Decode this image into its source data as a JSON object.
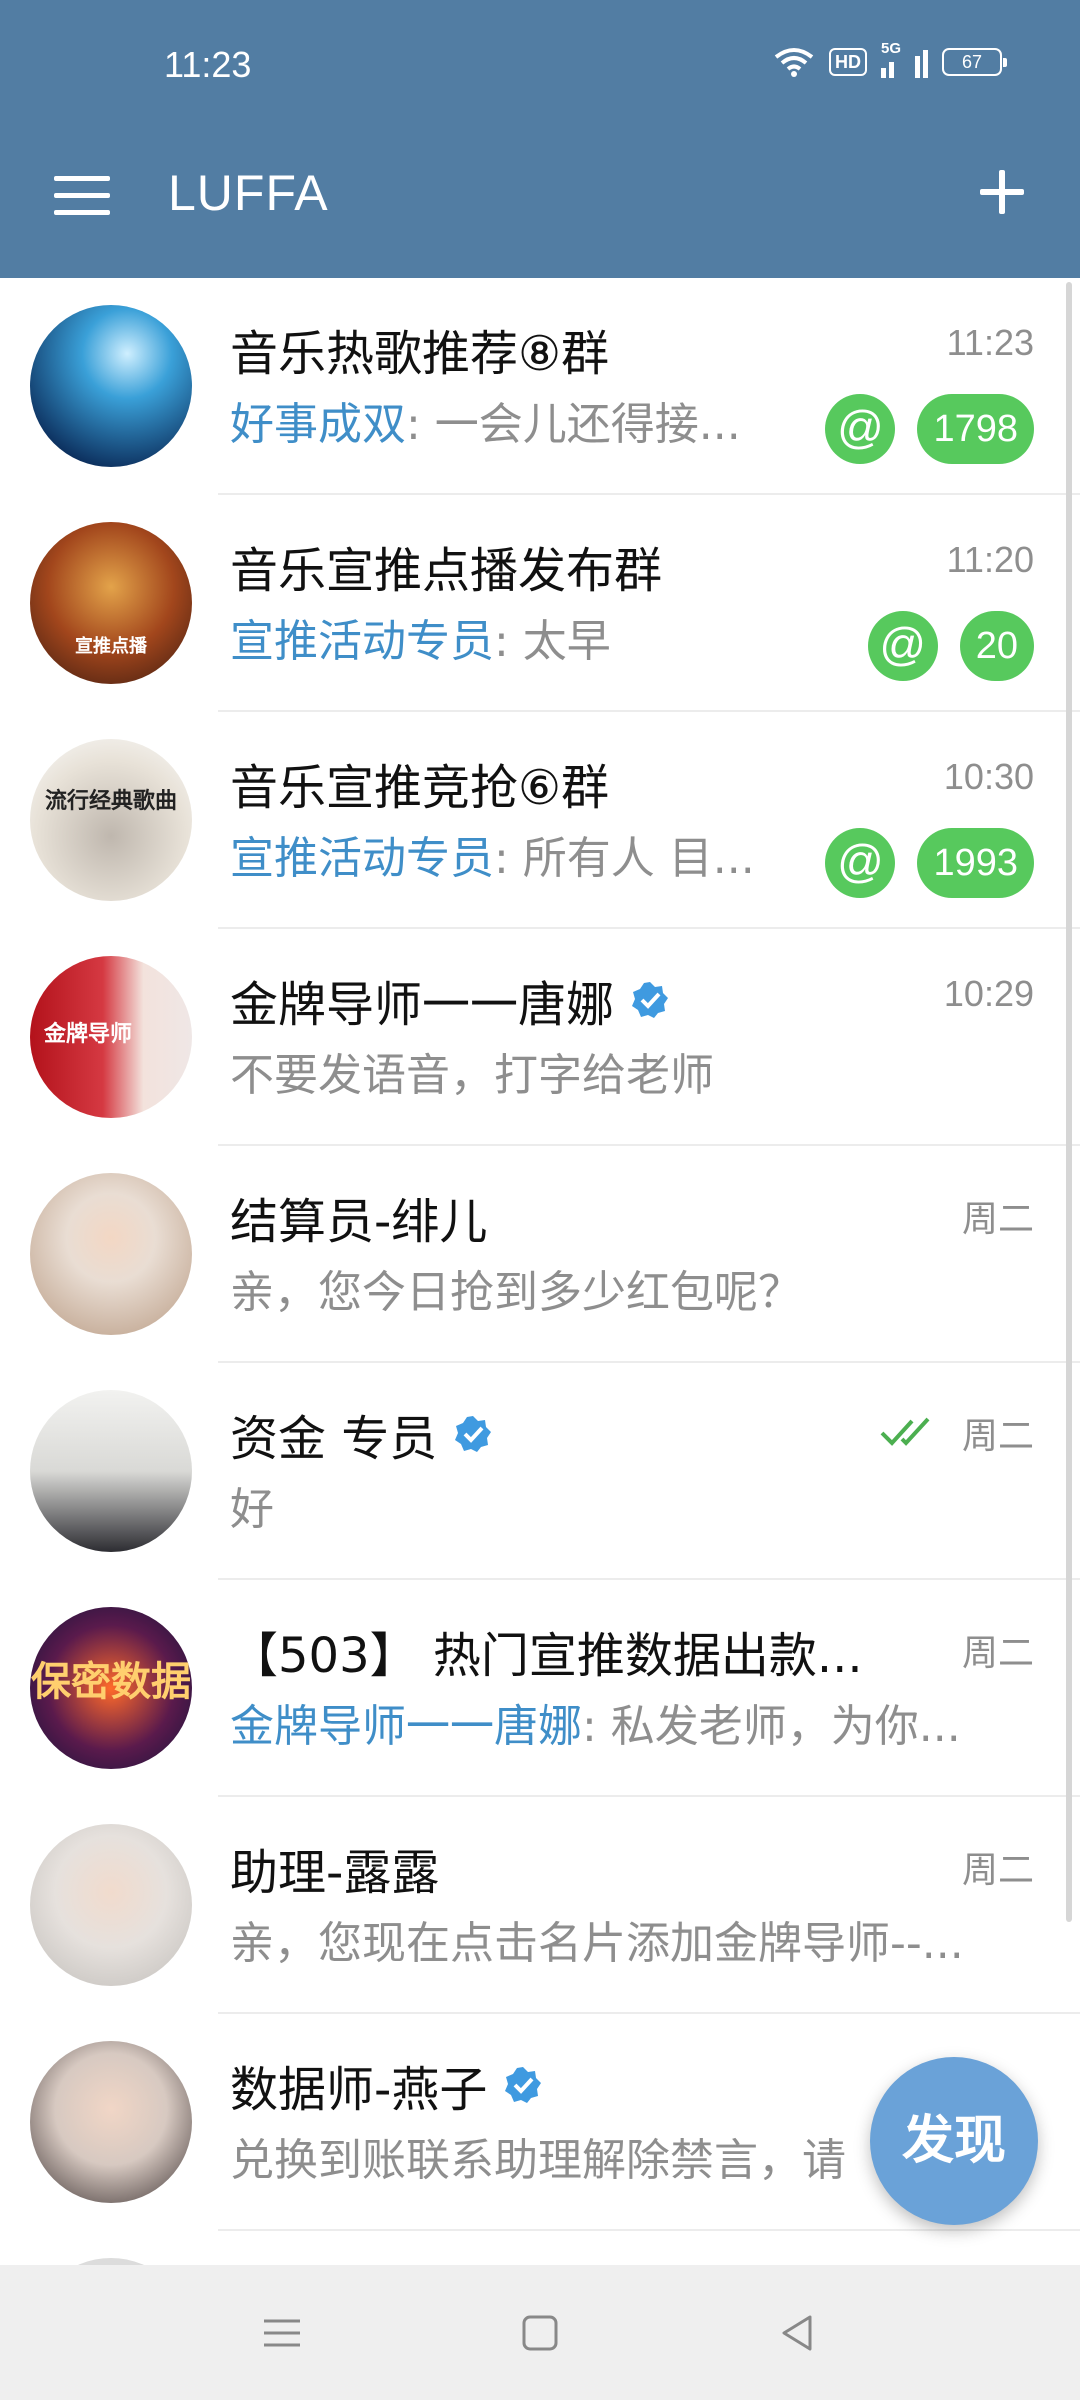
{
  "status_bar": {
    "time": "11:23",
    "network": "HD",
    "signal": "5G",
    "battery": "67"
  },
  "header": {
    "title": "LUFFA"
  },
  "chats": [
    {
      "name": "音乐热歌推荐⑧群",
      "time": "11:23",
      "sender": "好事成双",
      "message": ": 一会儿还得接...",
      "mention": "@",
      "count": "1798"
    },
    {
      "name": "音乐宣推点播发布群",
      "time": "11:20",
      "sender": "宣推活动专员",
      "message": ": 太早",
      "mention": "@",
      "count": "20",
      "avatar_text": "宣推点播"
    },
    {
      "name": "音乐宣推竞抢⑥群",
      "time": "10:30",
      "sender": "宣推活动专员",
      "message": ": 所有人 目...",
      "mention": "@",
      "count": "1993",
      "avatar_text": "流行经典歌曲"
    },
    {
      "name": "金牌导师一一唐娜",
      "time": "10:29",
      "message": "不要发语音，打字给老师",
      "verified": true,
      "avatar_text": "金牌导师"
    },
    {
      "name": "结算员-绯儿",
      "time": "周二",
      "message": "亲，您今日抢到多少红包呢？"
    },
    {
      "name": "资金 专员",
      "time": "周二",
      "message": "好",
      "verified": true,
      "read": true
    },
    {
      "name": "【503】 热门宣推数据出款...",
      "time": "周二",
      "sender": "金牌导师一一唐娜",
      "message": ": 私发老师，为你...",
      "avatar_text": "保密数据"
    },
    {
      "name": "助理-露露",
      "time": "周二",
      "message": "亲，您现在点击名片添加金牌导师--..."
    },
    {
      "name": "数据师-燕子",
      "time": "",
      "message": "兑换到账联系助理解除禁言，请",
      "verified": true
    }
  ],
  "fab": {
    "label": "发现"
  },
  "colors": {
    "header": "#527da3",
    "badge": "#57c95d",
    "sender": "#3f8ec8",
    "fab": "#6aa2d8"
  }
}
